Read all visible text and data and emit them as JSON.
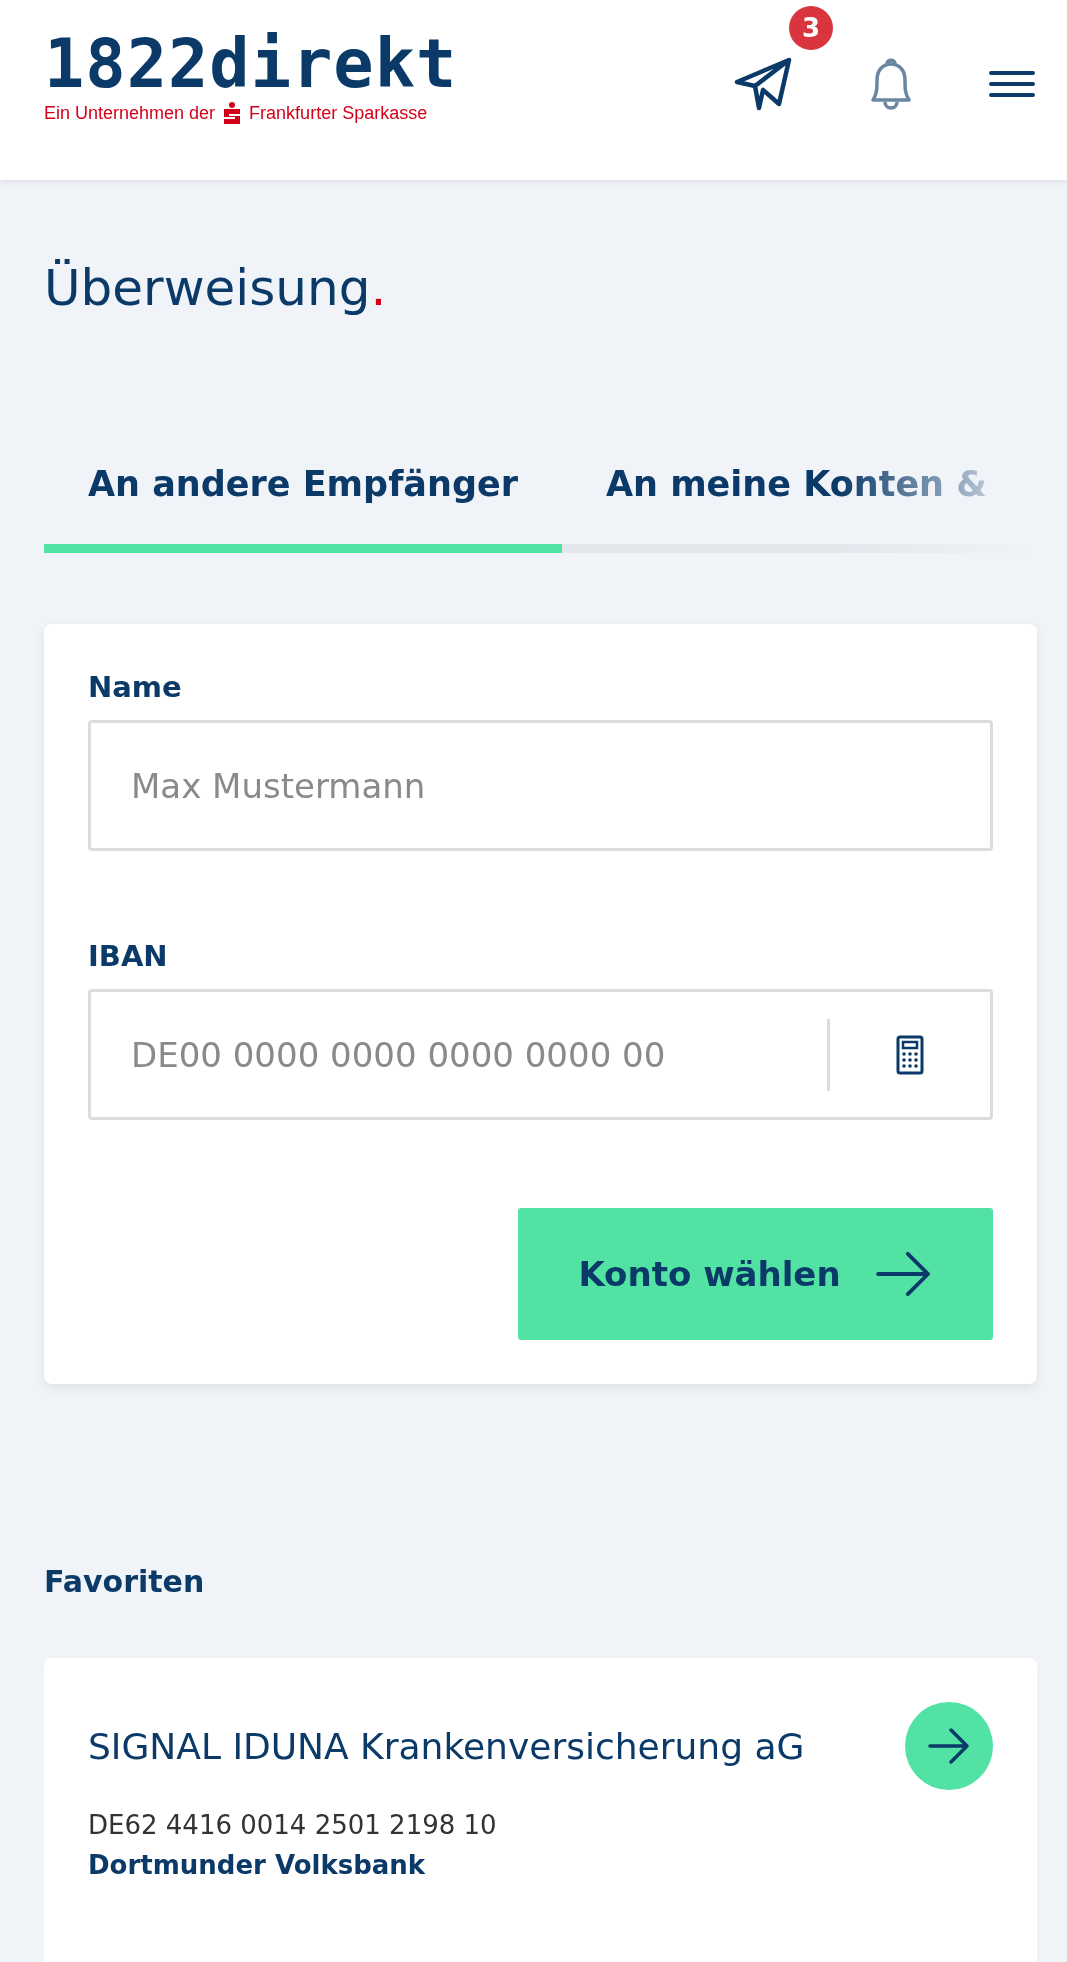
{
  "header": {
    "logo": "1822direkt",
    "tagline_prefix": "Ein Unternehmen der",
    "tagline_suffix": "Frankfurter Sparkasse",
    "badge": "3"
  },
  "title": "Überweisung",
  "title_mark": ".",
  "tabs": [
    {
      "label": "An andere Empfänger",
      "selected": true
    },
    {
      "label": "An meine Konten &",
      "selected": false
    }
  ],
  "form": {
    "fields": [
      {
        "kind": "text",
        "label": "Name",
        "placeholder": "Max Mustermann"
      },
      {
        "kind": "iban",
        "label": "IBAN",
        "placeholder": "DE00 0000 0000 0000 0000 00"
      }
    ],
    "submit": "Konto wählen"
  },
  "favorites": {
    "heading": "Favoriten",
    "items": [
      {
        "name": "SIGNAL IDUNA Krankenversicherung aG",
        "iban": "DE62 4416 0014 2501 2198 10",
        "bank": "Dortmunder Volksbank"
      }
    ]
  }
}
